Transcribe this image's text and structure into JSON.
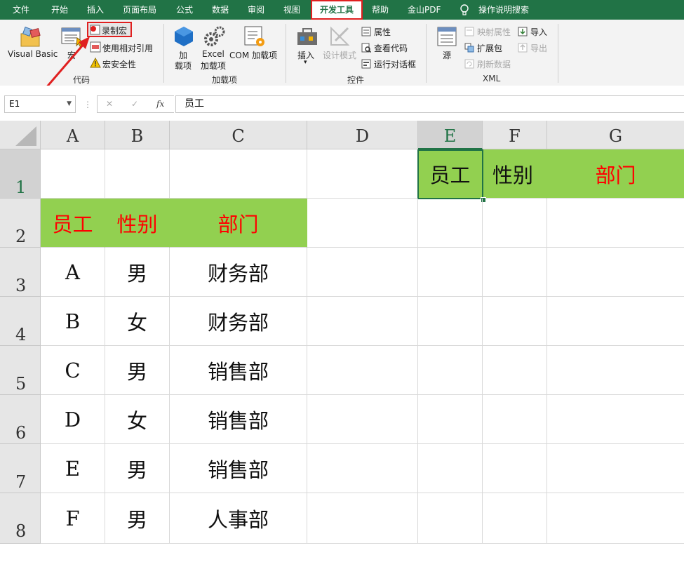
{
  "tabs": [
    "文件",
    "开始",
    "插入",
    "页面布局",
    "公式",
    "数据",
    "审阅",
    "视图",
    "开发工具",
    "帮助",
    "金山PDF",
    "操作说明搜索"
  ],
  "ribbon": {
    "code": {
      "visual_basic": "Visual Basic",
      "macros": "宏",
      "record_macro": "录制宏",
      "relative_ref": "使用相对引用",
      "macro_security": "宏安全性",
      "group_label": "代码"
    },
    "addins": {
      "addin_line1": "加",
      "addin_line2": "载项",
      "excel_line1": "Excel",
      "excel_line2": "加载项",
      "com": "COM 加载项",
      "group_label": "加载项"
    },
    "controls": {
      "insert": "插入",
      "design_mode": "设计模式",
      "properties": "属性",
      "view_code": "查看代码",
      "run_dialog": "运行对话框",
      "group_label": "控件"
    },
    "xml": {
      "source": "源",
      "map_props": "映射属性",
      "expansion": "扩展包",
      "refresh": "刷新数据",
      "import": "导入",
      "export": "导出",
      "group_label": "XML"
    }
  },
  "formula_bar": {
    "name_box": "E1",
    "cancel": "✕",
    "enter": "✓",
    "fx": "fx",
    "content": "员工"
  },
  "grid": {
    "columns": [
      "A",
      "B",
      "C",
      "D",
      "E",
      "F",
      "G"
    ],
    "rows": [
      "1",
      "2",
      "3",
      "4",
      "5",
      "6",
      "7",
      "8"
    ],
    "selected_cell": "E1",
    "header_fill": "#92d050",
    "cells": {
      "E1": "员工",
      "F1": "性别",
      "G1": "部门",
      "A2": "员工",
      "B2": "性别",
      "C2": "部门",
      "A3": "A",
      "B3": "男",
      "C3": "财务部",
      "A4": "B",
      "B4": "女",
      "C4": "财务部",
      "A5": "C",
      "B5": "男",
      "C5": "销售部",
      "A6": "D",
      "B6": "女",
      "C6": "销售部",
      "A7": "E",
      "B7": "男",
      "C7": "销售部",
      "A8": "F",
      "B8": "男",
      "C8": "人事部"
    }
  }
}
